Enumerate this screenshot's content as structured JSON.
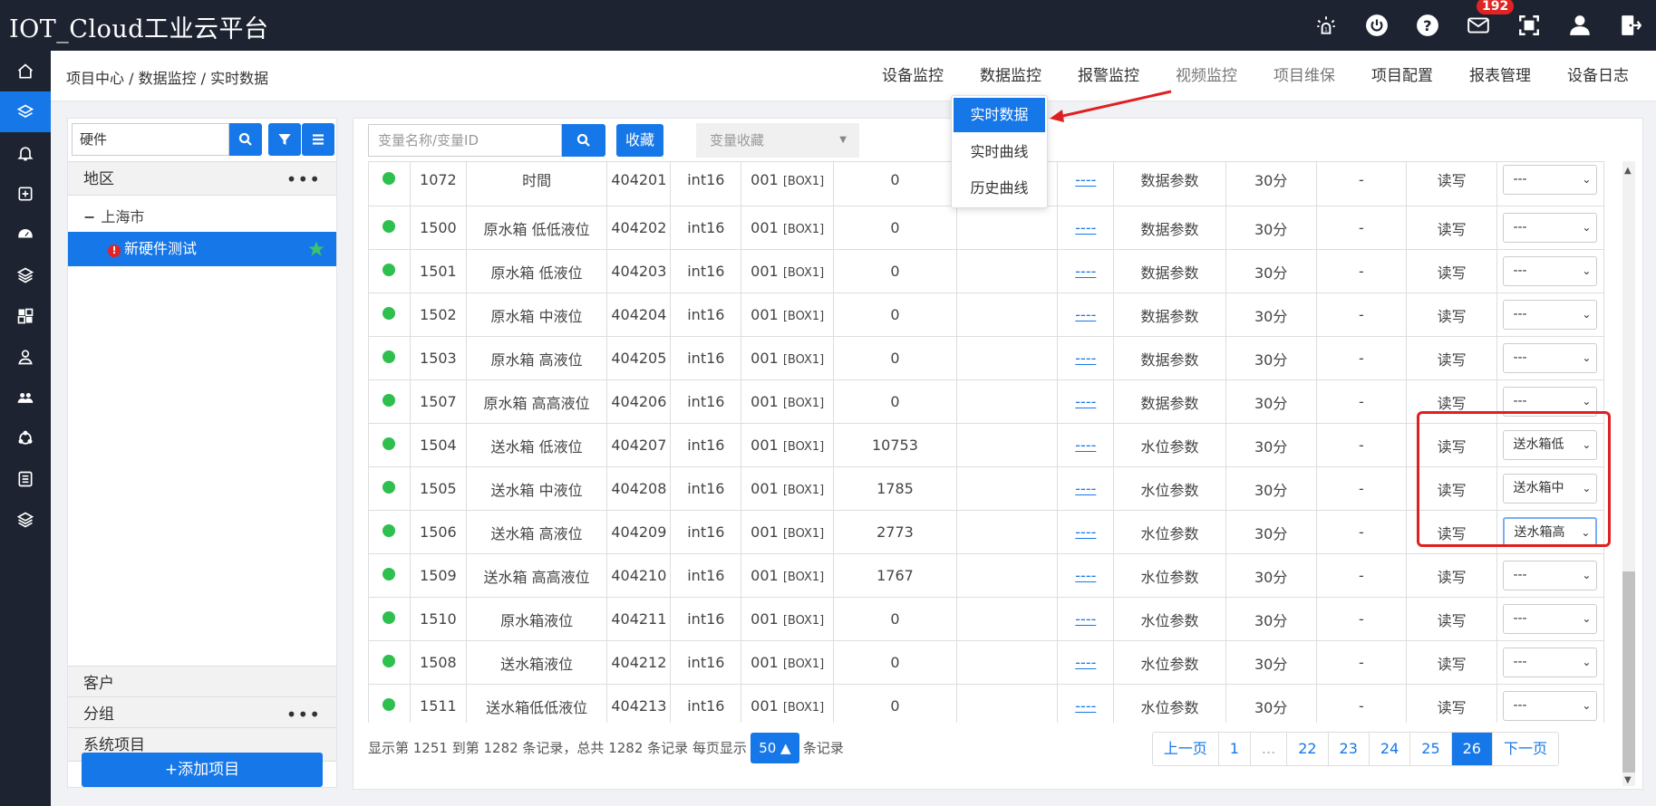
{
  "app": {
    "title": "IOT_Cloud工业云平台"
  },
  "topbar": {
    "mail_badge": "192"
  },
  "breadcrumb": "项目中心 / 数据监控 / 实时数据",
  "nav": [
    {
      "label": "设备监控"
    },
    {
      "label": "数据监控"
    },
    {
      "label": "报警监控"
    },
    {
      "label": "视频监控"
    },
    {
      "label": "项目维保"
    },
    {
      "label": "项目配置"
    },
    {
      "label": "报表管理"
    },
    {
      "label": "设备日志"
    }
  ],
  "dropdown": [
    {
      "label": "实时数据"
    },
    {
      "label": "实时曲线"
    },
    {
      "label": "历史曲线"
    }
  ],
  "left": {
    "search_value": "硬件",
    "region_header": "地区",
    "city": "上海市",
    "selected_project": "新硬件测试",
    "customer_header": "客户",
    "group_header": "分组",
    "system_header": "系统项目",
    "add_button": "+添加项目"
  },
  "toolbar": {
    "search_placeholder": "变量名称/变量ID",
    "fav_button": "收藏",
    "fav_select": "变量收藏"
  },
  "table": {
    "rows": [
      {
        "id": "1072",
        "name": "时間",
        "addr": "404201",
        "type": "int16",
        "dev": "001",
        "box": "[BOX1]",
        "value": "0",
        "link": "----",
        "group": "数据参数",
        "period": "30分",
        "dash": "-",
        "rw": "读写",
        "sel": "---"
      },
      {
        "id": "1500",
        "name": "原水箱 低低液位",
        "addr": "404202",
        "type": "int16",
        "dev": "001",
        "box": "[BOX1]",
        "value": "0",
        "link": "----",
        "group": "数据参数",
        "period": "30分",
        "dash": "-",
        "rw": "读写",
        "sel": "---"
      },
      {
        "id": "1501",
        "name": "原水箱 低液位",
        "addr": "404203",
        "type": "int16",
        "dev": "001",
        "box": "[BOX1]",
        "value": "0",
        "link": "----",
        "group": "数据参数",
        "period": "30分",
        "dash": "-",
        "rw": "读写",
        "sel": "---"
      },
      {
        "id": "1502",
        "name": "原水箱 中液位",
        "addr": "404204",
        "type": "int16",
        "dev": "001",
        "box": "[BOX1]",
        "value": "0",
        "link": "----",
        "group": "数据参数",
        "period": "30分",
        "dash": "-",
        "rw": "读写",
        "sel": "---"
      },
      {
        "id": "1503",
        "name": "原水箱 高液位",
        "addr": "404205",
        "type": "int16",
        "dev": "001",
        "box": "[BOX1]",
        "value": "0",
        "link": "----",
        "group": "数据参数",
        "period": "30分",
        "dash": "-",
        "rw": "读写",
        "sel": "---"
      },
      {
        "id": "1507",
        "name": "原水箱 高高液位",
        "addr": "404206",
        "type": "int16",
        "dev": "001",
        "box": "[BOX1]",
        "value": "0",
        "link": "----",
        "group": "数据参数",
        "period": "30分",
        "dash": "-",
        "rw": "读写",
        "sel": "---"
      },
      {
        "id": "1504",
        "name": "送水箱 低液位",
        "addr": "404207",
        "type": "int16",
        "dev": "001",
        "box": "[BOX1]",
        "value": "10753",
        "link": "----",
        "group": "水位参数",
        "period": "30分",
        "dash": "-",
        "rw": "读写",
        "sel": "送水箱低"
      },
      {
        "id": "1505",
        "name": "送水箱 中液位",
        "addr": "404208",
        "type": "int16",
        "dev": "001",
        "box": "[BOX1]",
        "value": "1785",
        "link": "----",
        "group": "水位参数",
        "period": "30分",
        "dash": "-",
        "rw": "读写",
        "sel": "送水箱中"
      },
      {
        "id": "1506",
        "name": "送水箱 高液位",
        "addr": "404209",
        "type": "int16",
        "dev": "001",
        "box": "[BOX1]",
        "value": "2773",
        "link": "----",
        "group": "水位参数",
        "period": "30分",
        "dash": "-",
        "rw": "读写",
        "sel": "送水箱高"
      },
      {
        "id": "1509",
        "name": "送水箱 高高液位",
        "addr": "404210",
        "type": "int16",
        "dev": "001",
        "box": "[BOX1]",
        "value": "1767",
        "link": "----",
        "group": "水位参数",
        "period": "30分",
        "dash": "-",
        "rw": "读写",
        "sel": "---"
      },
      {
        "id": "1510",
        "name": "原水箱液位",
        "addr": "404211",
        "type": "int16",
        "dev": "001",
        "box": "[BOX1]",
        "value": "0",
        "link": "----",
        "group": "水位参数",
        "period": "30分",
        "dash": "-",
        "rw": "读写",
        "sel": "---"
      },
      {
        "id": "1508",
        "name": "送水箱液位",
        "addr": "404212",
        "type": "int16",
        "dev": "001",
        "box": "[BOX1]",
        "value": "0",
        "link": "----",
        "group": "水位参数",
        "period": "30分",
        "dash": "-",
        "rw": "读写",
        "sel": "---"
      },
      {
        "id": "1511",
        "name": "送水箱低低液位",
        "addr": "404213",
        "type": "int16",
        "dev": "001",
        "box": "[BOX1]",
        "value": "0",
        "link": "----",
        "group": "水位参数",
        "period": "30分",
        "dash": "-",
        "rw": "读写",
        "sel": "---"
      }
    ]
  },
  "footer": {
    "info_prefix": "显示第 1251 到第 1282 条记录，总共 1282 条记录 每页显示",
    "page_size": "50 ▲",
    "info_suffix": "条记录"
  },
  "pagination": [
    {
      "label": "上一页"
    },
    {
      "label": "1"
    },
    {
      "label": "..."
    },
    {
      "label": "22"
    },
    {
      "label": "23"
    },
    {
      "label": "24"
    },
    {
      "label": "25"
    },
    {
      "label": "26"
    },
    {
      "label": "下一页"
    }
  ],
  "colors": {
    "accent": "#1677e8",
    "topbar": "#1d2330",
    "status_ok": "#2fbf4f",
    "highlight": "#e02020"
  }
}
